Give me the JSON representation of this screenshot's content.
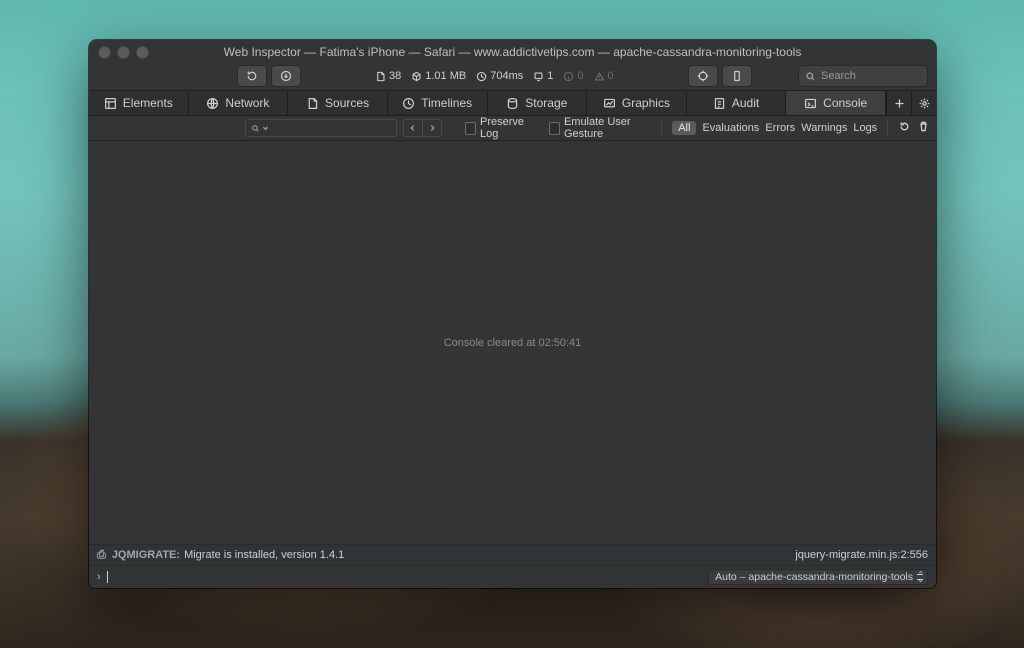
{
  "window": {
    "title": "Web Inspector — Fatima's iPhone — Safari — www.addictivetips.com — apache-cassandra-monitoring-tools"
  },
  "toolbar": {
    "metrics": {
      "resources": "38",
      "size": "1.01 MB",
      "time": "704ms",
      "requests": "1",
      "info": "0",
      "warnings": "0"
    },
    "search_placeholder": "Search"
  },
  "tabs": {
    "items": [
      {
        "label": "Elements"
      },
      {
        "label": "Network"
      },
      {
        "label": "Sources"
      },
      {
        "label": "Timelines"
      },
      {
        "label": "Storage"
      },
      {
        "label": "Graphics"
      },
      {
        "label": "Audit"
      },
      {
        "label": "Console"
      }
    ]
  },
  "filterbar": {
    "preserve": "Preserve Log",
    "emulate": "Emulate User Gesture",
    "all": "All",
    "evaluations": "Evaluations",
    "errors": "Errors",
    "warnings": "Warnings",
    "logs": "Logs"
  },
  "console": {
    "cleared": "Console cleared at 02:50:41",
    "log_prefix": "JQMIGRATE:",
    "log_message": "Migrate is installed, version 1.4.1",
    "log_source": "jquery-migrate.min.js:2:556",
    "context": "Auto – apache-cassandra-monitoring-tools"
  }
}
